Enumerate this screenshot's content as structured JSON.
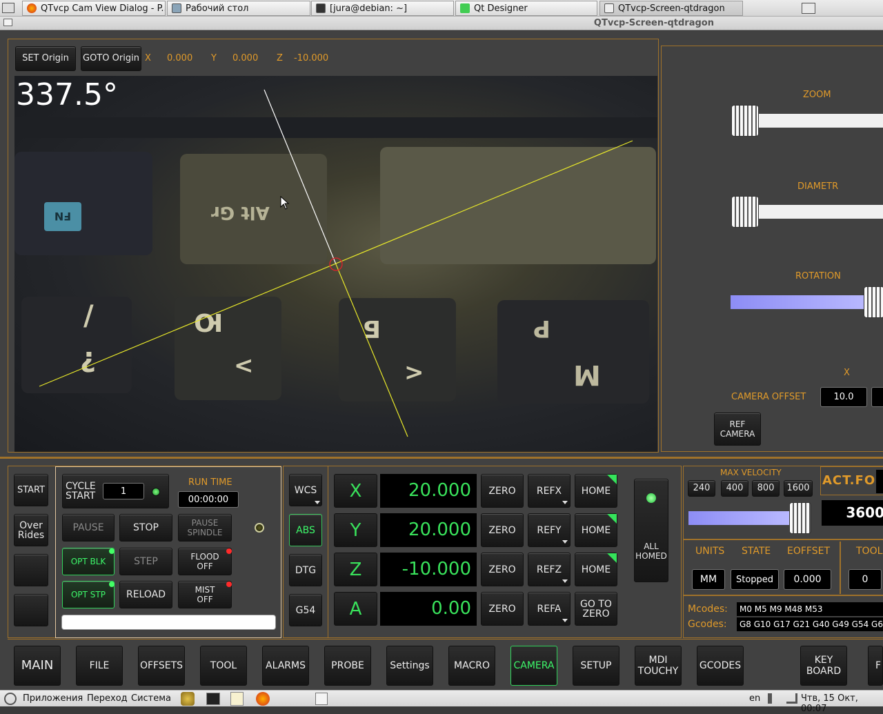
{
  "taskbar": {
    "tasks": [
      "QTvcp Cam View Dialog - P...",
      "Рабочий стол",
      "[jura@debian: ~]",
      "Qt Designer",
      "QTvcp-Screen-qtdragon"
    ]
  },
  "window": {
    "title": "QTvcp-Screen-qtdragon"
  },
  "camera": {
    "set_origin": "SET Origin",
    "goto_origin": "GOTO Origin",
    "x_label": "X",
    "x_val": "0.000",
    "y_label": "Y",
    "y_val": "0.000",
    "z_label": "Z",
    "z_val": "-10.000",
    "angle": "337.5°",
    "keys": [
      "FN",
      "Alt Gr",
      "/",
      "?",
      "Ю",
      "<",
      "Б",
      ">",
      "Р",
      "М"
    ]
  },
  "camera_side": {
    "zoom": "ZOOM",
    "diametr": "DIAMETR",
    "rotation": "ROTATION",
    "x_header": "X",
    "camera_offset": "CAMERA OFFSET",
    "offset_x": "10.0",
    "ref_camera": "REF CAMERA",
    "zoom_level": 0.0,
    "diametr_level": 0.0,
    "rotation_level": 1.0
  },
  "control": {
    "start": "START",
    "overrides": "Over Rides",
    "cycle_start": "CYCLE START",
    "cycle_count": "1",
    "run_time_label": "RUN TIME",
    "run_time": "00:00:00",
    "pause": "PAUSE",
    "stop": "STOP",
    "pause_spindle": "PAUSE SPINDLE",
    "opt_blk": "OPT BLK",
    "step": "STEP",
    "flood": "FLOOD OFF",
    "opt_stp": "OPT STP",
    "reload": "RELOAD",
    "mist": "MIST OFF"
  },
  "dro": {
    "wcs": "WCS",
    "abs": "ABS",
    "dtg": "DTG",
    "g54": "G54",
    "axes": [
      {
        "name": "X",
        "value": "20.000",
        "zero": "ZERO",
        "ref": "REFX",
        "home": "HOME"
      },
      {
        "name": "Y",
        "value": "20.000",
        "zero": "ZERO",
        "ref": "REFY",
        "home": "HOME"
      },
      {
        "name": "Z",
        "value": "-10.000",
        "zero": "ZERO",
        "ref": "REFZ",
        "home": "HOME"
      },
      {
        "name": "A",
        "value": "0.00",
        "zero": "ZERO",
        "ref": "REFA",
        "home": "GO TO ZERO"
      }
    ],
    "all_homed": "ALL HOMED"
  },
  "status": {
    "max_velocity": "MAX VELOCITY",
    "velocities": [
      "240",
      "400",
      "800",
      "1600"
    ],
    "velocity_level": 0.75,
    "act_fo": "ACT.FO.",
    "feed": "3600",
    "units_label": "UNITS",
    "state_label": "STATE",
    "eoffset_label": "EOFFSET",
    "tool_label": "TOOL",
    "units": "MM",
    "state": "Stopped",
    "eoffset": "0.000",
    "tool": "0",
    "mcodes_label": "Mcodes:",
    "mcodes": "M0 M5 M9 M48 M53",
    "gcodes_label": "Gcodes:",
    "gcodes": "G8 G10 G17 G21 G40 G49 G54 G6"
  },
  "nav": [
    "MAIN",
    "FILE",
    "OFFSETS",
    "TOOL",
    "ALARMS",
    "PROBE",
    "Settings",
    "MACRO",
    "CAMERA",
    "SETUP",
    "MDI TOUCHY",
    "GCODES",
    "KEY BOARD",
    "F"
  ],
  "sysbar": {
    "apps": "Приложения",
    "go": "Переход",
    "system": "Система",
    "lang": "en",
    "datetime": "Чтв, 15 Окт, 00:07"
  }
}
